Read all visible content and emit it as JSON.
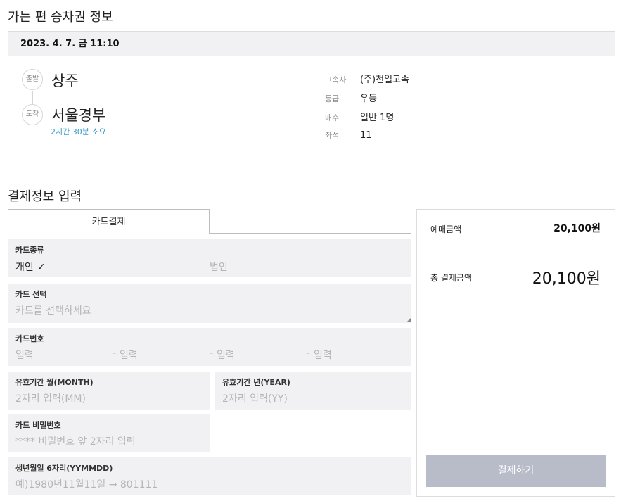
{
  "outbound": {
    "title": "가는 편 승차권 정보",
    "datetime": "2023. 4. 7. 금 11:10",
    "departure_badge": "출발",
    "departure": "상주",
    "arrival_badge": "도착",
    "arrival": "서울경부",
    "duration": "2시간 30분 소요",
    "info": [
      {
        "label": "고속사",
        "value": "(주)천일고속"
      },
      {
        "label": "등급",
        "value": "우등"
      },
      {
        "label": "매수",
        "value": "일반 1명"
      },
      {
        "label": "좌석",
        "value": "11"
      }
    ]
  },
  "payment": {
    "title": "결제정보 입력",
    "tab_label": "카드결제",
    "card_type": {
      "label": "카드종류",
      "option_personal": "개인",
      "check_mark": "✓",
      "option_corporate": "법인"
    },
    "card_select": {
      "label": "카드 선택",
      "placeholder": "카드를 선택하세요"
    },
    "card_number": {
      "label": "카드번호",
      "placeholder1": "입력",
      "sep2": "-",
      "placeholder2": "입력",
      "sep3": "-",
      "placeholder3": "입력",
      "sep4": "-",
      "placeholder4": "입력"
    },
    "expiry_month": {
      "label": "유효기간 월(MONTH)",
      "placeholder": "2자리 입력(MM)"
    },
    "expiry_year": {
      "label": "유효기간 년(YEAR)",
      "placeholder": "2자리 입력(YY)"
    },
    "card_pw": {
      "label": "카드 비밀번호",
      "placeholder": "**** 비밀번호 앞 2자리 입력"
    },
    "birth": {
      "label": "생년월일 6자리(YYMMDD)",
      "placeholder": "예)1980년11월11일 → 801111"
    }
  },
  "summary": {
    "reserve_label": "예매금액",
    "reserve_amount": "20,100원",
    "total_label": "총 결제금액",
    "total_amount": "20,100원",
    "pay_button": "결제하기"
  }
}
